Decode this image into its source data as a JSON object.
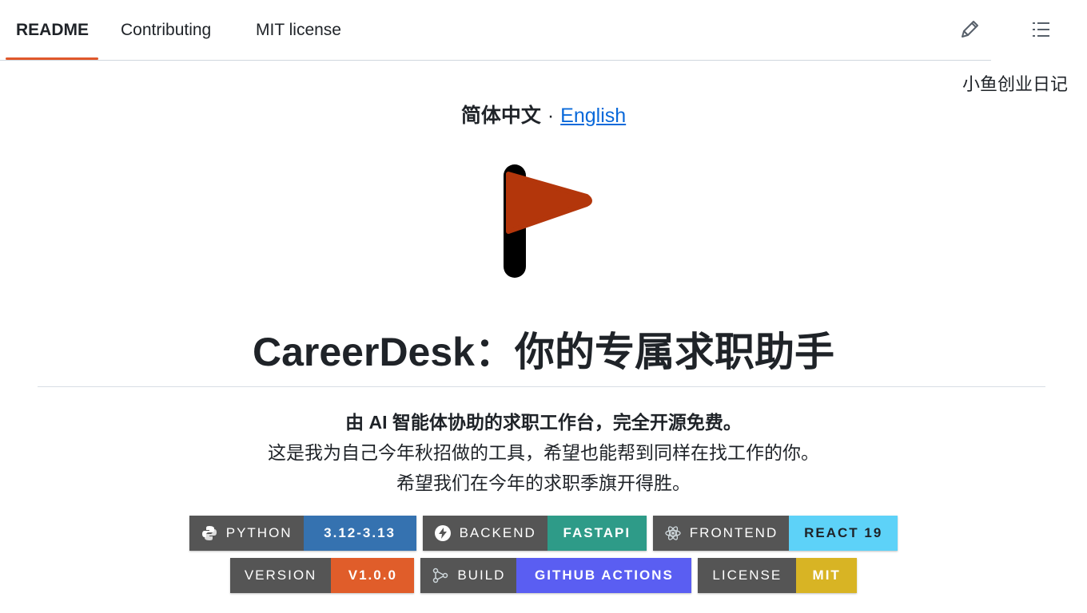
{
  "tabs": [
    {
      "label": "README",
      "active": true
    },
    {
      "label": "Contributing",
      "active": false
    },
    {
      "label": "MIT license",
      "active": false
    }
  ],
  "toolbar": {
    "edit_icon": "pencil-icon",
    "outline_icon": "list-icon"
  },
  "side_note": "小鱼创业日记",
  "lang": {
    "current": "简体中文",
    "separator": "·",
    "other": "English"
  },
  "logo_icon": "flag-icon",
  "title": "CareerDesk：你的专属求职助手",
  "lead": {
    "line1": "由 AI 智能体协助的求职工作台，完全开源免费。",
    "line2": "这是我为自己今年秋招做的工具，希望也能帮到同样在找工作的你。",
    "line3": "希望我们在今年的求职季旗开得胜。"
  },
  "badges_row1": [
    {
      "label": "PYTHON",
      "message": "3.12-3.13",
      "color": "#3572b0",
      "icon": "python-icon"
    },
    {
      "label": "BACKEND",
      "message": "FASTAPI",
      "color": "#2e9b88",
      "icon": "bolt-icon"
    },
    {
      "label": "FRONTEND",
      "message": "REACT 19",
      "color": "#5dd2f8",
      "icon": "atom-icon",
      "dark_text": true
    }
  ],
  "badges_row2": [
    {
      "label": "VERSION",
      "message": "V1.0.0",
      "color": "#e05d2a"
    },
    {
      "label": "BUILD",
      "message": "GITHUB ACTIONS",
      "color": "#5a5ef2",
      "icon": "actions-icon"
    },
    {
      "label": "LICENSE",
      "message": "MIT",
      "color": "#d8b424"
    }
  ],
  "colors": {
    "accent": "#e0582b",
    "link": "#0969da",
    "flag": "#b3360b"
  }
}
